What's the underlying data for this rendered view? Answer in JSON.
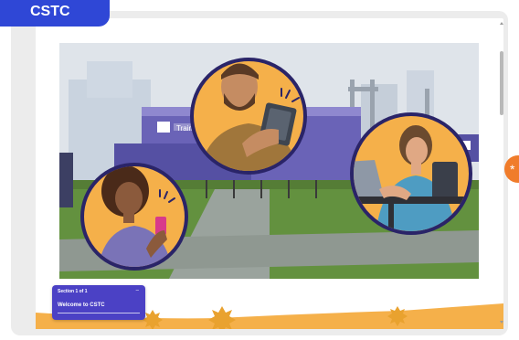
{
  "brand": {
    "label": "CSTC"
  },
  "hero": {
    "sign_text": "Train"
  },
  "section_card": {
    "meta": "Section 1 of 1",
    "title": "Welcome to CSTC",
    "chevron": "–"
  },
  "help_button": {
    "icon": "*"
  },
  "colors": {
    "brand_blue": "#2f47d6",
    "card_purple": "#4b41c5",
    "accent_orange": "#f5b04a",
    "help_orange": "#f07c2b"
  }
}
